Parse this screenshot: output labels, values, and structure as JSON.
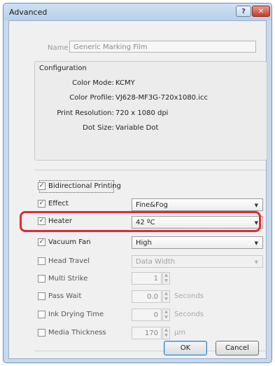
{
  "window": {
    "title": "Advanced",
    "help_label": "?",
    "close_label": "✕"
  },
  "name": {
    "label": "Name",
    "value": "Generic Marking Film"
  },
  "configuration": {
    "title": "Configuration",
    "items": [
      {
        "label": "Color Mode:",
        "value": "KCMY"
      },
      {
        "label": "Color Profile:",
        "value": "VJ628-MF3G-720x1080.icc"
      },
      {
        "label": "Print Resolution:",
        "value": "720 x 1080 dpi"
      },
      {
        "label": "Dot Size:",
        "value": "Variable Dot"
      }
    ]
  },
  "options": {
    "bidirectional": {
      "label": "Bidirectional Printing",
      "checked": true
    },
    "effect": {
      "label": "Effect",
      "checked": true,
      "value": "Fine&Fog"
    },
    "heater": {
      "label": "Heater",
      "checked": true,
      "value": "42 ºC"
    },
    "vacuum_fan": {
      "label": "Vacuum Fan",
      "checked": true,
      "value": "High"
    },
    "head_travel": {
      "label": "Head Travel",
      "checked": false,
      "value": "Data Width"
    },
    "multi_strike": {
      "label": "Multi Strike",
      "checked": false,
      "value": "1"
    },
    "pass_wait": {
      "label": "Pass Wait",
      "checked": false,
      "value": "0.0",
      "unit": "Seconds"
    },
    "ink_drying": {
      "label": "Ink Drying Time",
      "checked": false,
      "value": "0",
      "unit": "Seconds"
    },
    "media_thickness": {
      "label": "Media Thickness",
      "checked": false,
      "value": "170",
      "unit": "μm"
    }
  },
  "buttons": {
    "ok": "OK",
    "cancel": "Cancel"
  },
  "colors": {
    "highlight": "#e02a35",
    "title_bar": "#b9d0ea"
  }
}
